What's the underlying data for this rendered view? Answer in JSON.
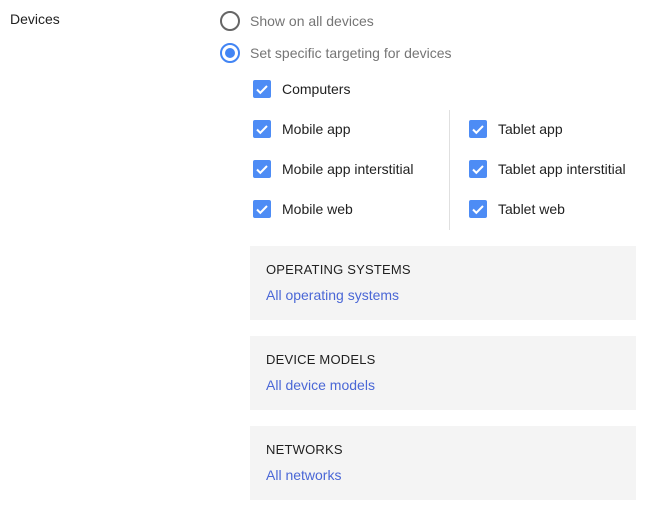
{
  "section_label": "Devices",
  "radios": [
    {
      "label": "Show on all devices",
      "selected": false
    },
    {
      "label": "Set specific targeting for devices",
      "selected": true
    }
  ],
  "checkboxes": {
    "computers": {
      "label": "Computers",
      "checked": true
    },
    "mobile_app": {
      "label": "Mobile app",
      "checked": true
    },
    "mobile_app_interstitial": {
      "label": "Mobile app interstitial",
      "checked": true
    },
    "mobile_web": {
      "label": "Mobile web",
      "checked": true
    },
    "tablet_app": {
      "label": "Tablet app",
      "checked": true
    },
    "tablet_app_interstitial": {
      "label": "Tablet app interstitial",
      "checked": true
    },
    "tablet_web": {
      "label": "Tablet web",
      "checked": true
    }
  },
  "panels": [
    {
      "title": "OPERATING SYSTEMS",
      "link": "All operating systems"
    },
    {
      "title": "DEVICE MODELS",
      "link": "All device models"
    },
    {
      "title": "NETWORKS",
      "link": "All networks"
    }
  ],
  "colors": {
    "accent": "#4285f4",
    "link": "#4a67d6",
    "panel_bg": "#f4f4f4"
  }
}
